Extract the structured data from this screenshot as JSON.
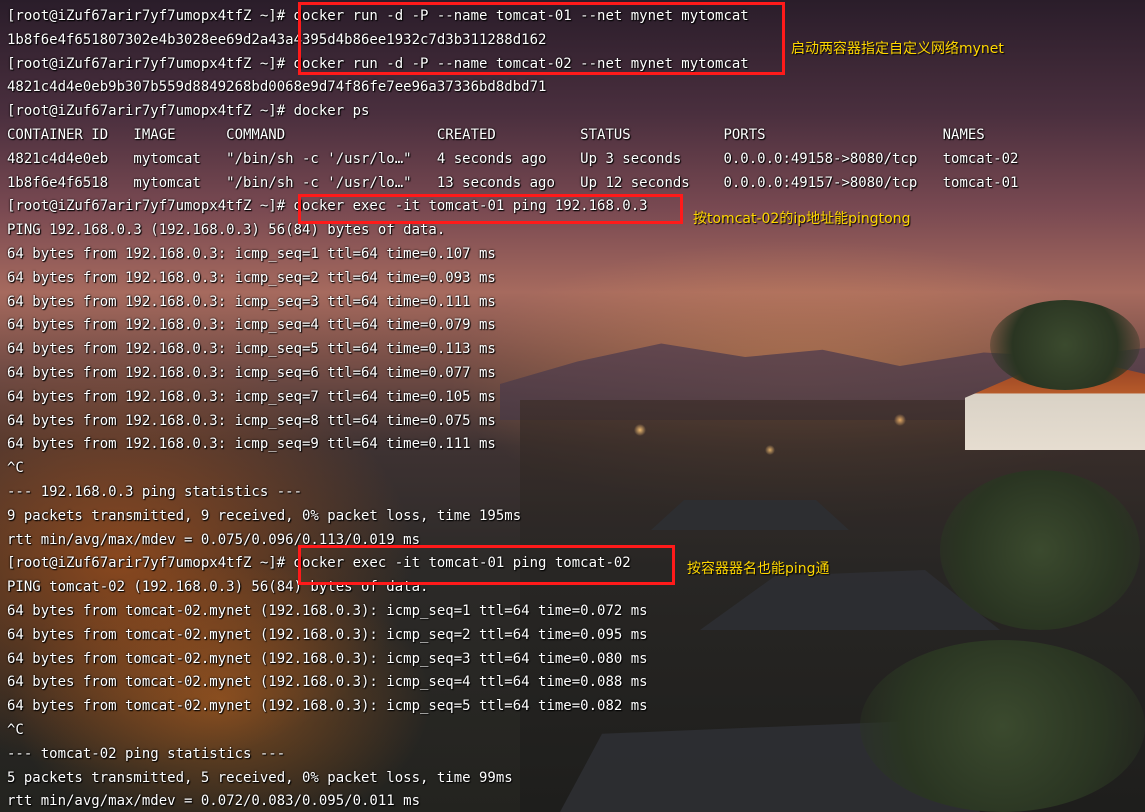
{
  "terminal": {
    "lines": [
      {
        "prompt": "[root@iZuf67arir7yf7umopx4tfZ ~]# ",
        "cmd": "docker run -d -P --name tomcat-01 --net mynet mytomcat"
      },
      {
        "text": "1b8f6e4f651807302e4b3028ee69d2a43a4395d4b86ee1932c7d3b311288d162"
      },
      {
        "prompt": "[root@iZuf67arir7yf7umopx4tfZ ~]# ",
        "cmd": "docker run -d -P --name tomcat-02 --net mynet mytomcat"
      },
      {
        "text": "4821c4d4e0eb9b307b559d8849268bd0068e9d74f86fe7ee96a37336bd8dbd71"
      },
      {
        "prompt": "[root@iZuf67arir7yf7umopx4tfZ ~]# ",
        "cmd": "docker ps"
      },
      {
        "text": "CONTAINER ID   IMAGE      COMMAND                  CREATED          STATUS           PORTS                     NAMES"
      },
      {
        "text": "4821c4d4e0eb   mytomcat   \"/bin/sh -c '/usr/lo…\"   4 seconds ago    Up 3 seconds     0.0.0.0:49158->8080/tcp   tomcat-02"
      },
      {
        "text": "1b8f6e4f6518   mytomcat   \"/bin/sh -c '/usr/lo…\"   13 seconds ago   Up 12 seconds    0.0.0.0:49157->8080/tcp   tomcat-01"
      },
      {
        "prompt": "[root@iZuf67arir7yf7umopx4tfZ ~]# ",
        "cmd": "docker exec -it tomcat-01 ping 192.168.0.3"
      },
      {
        "text": "PING 192.168.0.3 (192.168.0.3) 56(84) bytes of data."
      },
      {
        "text": "64 bytes from 192.168.0.3: icmp_seq=1 ttl=64 time=0.107 ms"
      },
      {
        "text": "64 bytes from 192.168.0.3: icmp_seq=2 ttl=64 time=0.093 ms"
      },
      {
        "text": "64 bytes from 192.168.0.3: icmp_seq=3 ttl=64 time=0.111 ms"
      },
      {
        "text": "64 bytes from 192.168.0.3: icmp_seq=4 ttl=64 time=0.079 ms"
      },
      {
        "text": "64 bytes from 192.168.0.3: icmp_seq=5 ttl=64 time=0.113 ms"
      },
      {
        "text": "64 bytes from 192.168.0.3: icmp_seq=6 ttl=64 time=0.077 ms"
      },
      {
        "text": "64 bytes from 192.168.0.3: icmp_seq=7 ttl=64 time=0.105 ms"
      },
      {
        "text": "64 bytes from 192.168.0.3: icmp_seq=8 ttl=64 time=0.075 ms"
      },
      {
        "text": "64 bytes from 192.168.0.3: icmp_seq=9 ttl=64 time=0.111 ms"
      },
      {
        "text": "^C"
      },
      {
        "text": "--- 192.168.0.3 ping statistics ---"
      },
      {
        "text": "9 packets transmitted, 9 received, 0% packet loss, time 195ms"
      },
      {
        "text": "rtt min/avg/max/mdev = 0.075/0.096/0.113/0.019 ms"
      },
      {
        "prompt": "[root@iZuf67arir7yf7umopx4tfZ ~]# ",
        "cmd": "docker exec -it tomcat-01 ping tomcat-02"
      },
      {
        "text": "PING tomcat-02 (192.168.0.3) 56(84) bytes of data."
      },
      {
        "text": "64 bytes from tomcat-02.mynet (192.168.0.3): icmp_seq=1 ttl=64 time=0.072 ms"
      },
      {
        "text": "64 bytes from tomcat-02.mynet (192.168.0.3): icmp_seq=2 ttl=64 time=0.095 ms"
      },
      {
        "text": "64 bytes from tomcat-02.mynet (192.168.0.3): icmp_seq=3 ttl=64 time=0.080 ms"
      },
      {
        "text": "64 bytes from tomcat-02.mynet (192.168.0.3): icmp_seq=4 ttl=64 time=0.088 ms"
      },
      {
        "text": "64 bytes from tomcat-02.mynet (192.168.0.3): icmp_seq=5 ttl=64 time=0.082 ms"
      },
      {
        "text": "^C"
      },
      {
        "text": "--- tomcat-02 ping statistics ---"
      },
      {
        "text": "5 packets transmitted, 5 received, 0% packet loss, time 99ms"
      },
      {
        "text": "rtt min/avg/max/mdev = 0.072/0.083/0.095/0.011 ms"
      }
    ]
  },
  "annotations": {
    "note1": "启动两容器指定自定义网络mynet",
    "note2": "按tomcat-02的ip地址能pingtong",
    "note3": "按容器器名也能ping通"
  },
  "colors": {
    "highlight": "#ff1a1a",
    "note": "#ffd700",
    "text": "#ffffff"
  }
}
